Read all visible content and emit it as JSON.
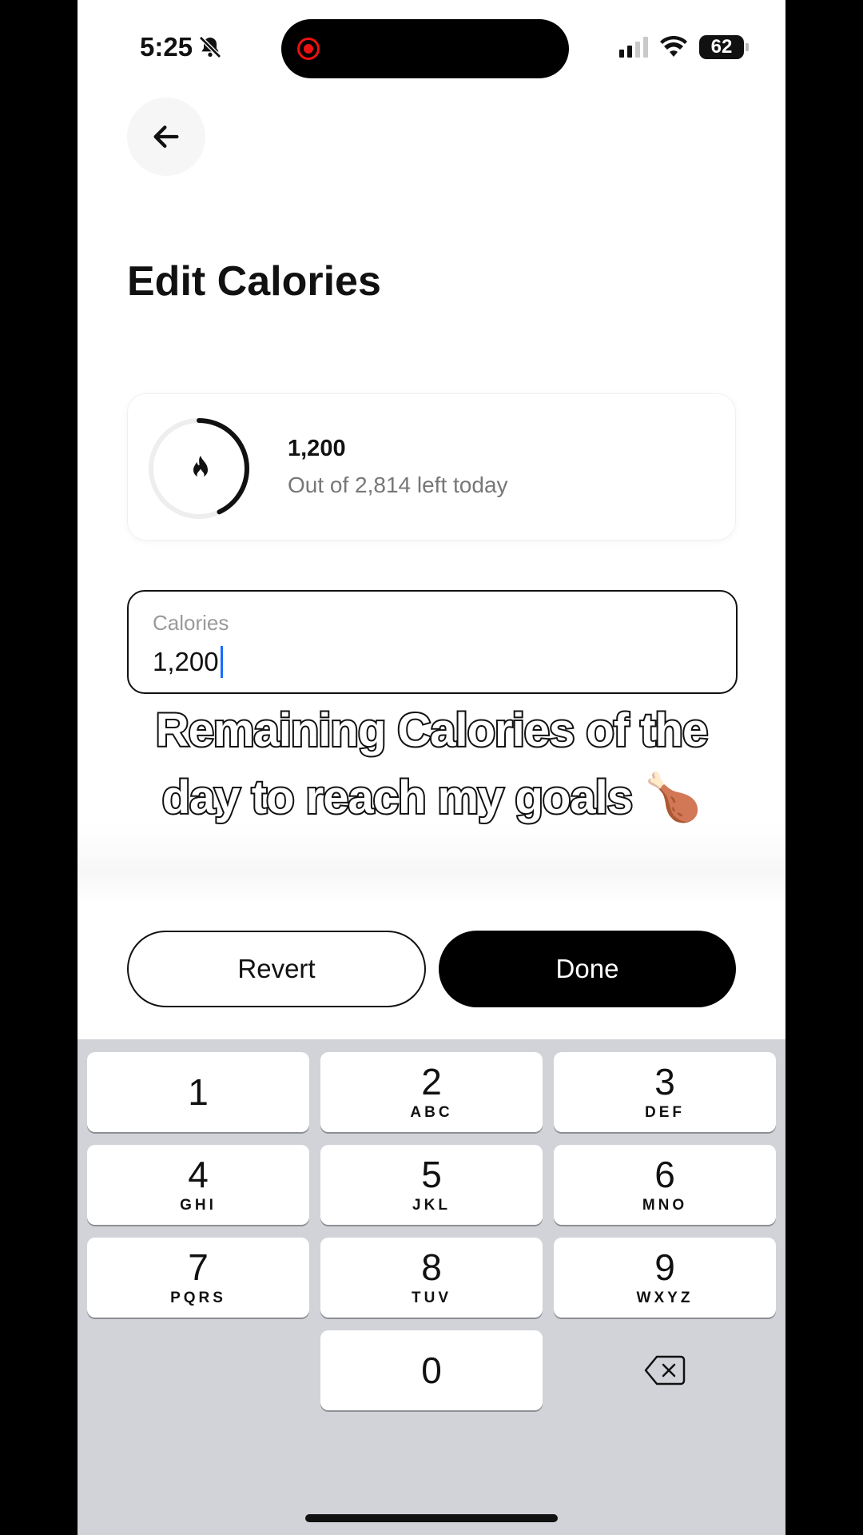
{
  "status_bar": {
    "time": "5:25",
    "battery": "62"
  },
  "header": {
    "title": "Edit Calories"
  },
  "summary": {
    "value": "1,200",
    "subtext": "Out of 2,814 left today",
    "progress": 0.43
  },
  "field": {
    "label": "Calories",
    "value": "1,200"
  },
  "caption": {
    "line1": "Remaining Calories of the",
    "line2": "day to reach my goals 🍗"
  },
  "actions": {
    "revert_label": "Revert",
    "done_label": "Done"
  },
  "keypad": {
    "keys": [
      {
        "digit": "1",
        "letters": ""
      },
      {
        "digit": "2",
        "letters": "ABC"
      },
      {
        "digit": "3",
        "letters": "DEF"
      },
      {
        "digit": "4",
        "letters": "GHI"
      },
      {
        "digit": "5",
        "letters": "JKL"
      },
      {
        "digit": "6",
        "letters": "MNO"
      },
      {
        "digit": "7",
        "letters": "PQRS"
      },
      {
        "digit": "8",
        "letters": "TUV"
      },
      {
        "digit": "9",
        "letters": "WXYZ"
      },
      {
        "digit": "0",
        "letters": ""
      }
    ]
  },
  "icons": {
    "back": "arrow-left-icon",
    "bell": "bell-slash-icon",
    "record": "record-icon",
    "signal": "cellular-signal-icon",
    "wifi": "wifi-icon",
    "battery": "battery-icon",
    "flame": "flame-icon",
    "delete": "backspace-icon"
  },
  "colors": {
    "accent": "#000000",
    "cursor": "#1a6cff",
    "keypad_bg": "#d1d3d9",
    "record": "#ee1111"
  }
}
